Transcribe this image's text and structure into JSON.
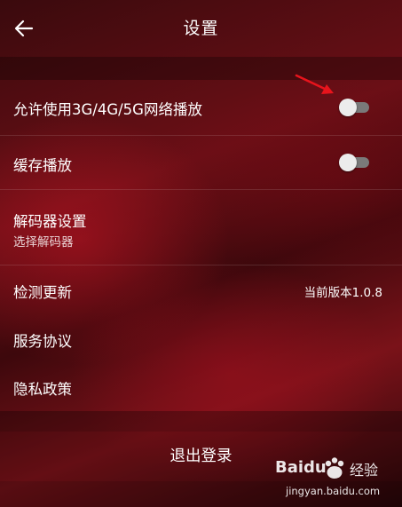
{
  "header": {
    "title": "设置",
    "back_icon": "arrow-left-icon"
  },
  "settings": {
    "allow_network_play": {
      "label": "允许使用3G/4G/5G网络播放",
      "enabled": false
    },
    "cache_play": {
      "label": "缓存播放",
      "enabled": false
    },
    "decoder": {
      "label": "解码器设置",
      "sublabel": "选择解码器"
    },
    "check_update": {
      "label": "检测更新",
      "value": "当前版本1.0.8"
    },
    "service_agreement": {
      "label": "服务协议"
    },
    "privacy_policy": {
      "label": "隐私政策"
    }
  },
  "logout": {
    "label": "退出登录"
  },
  "watermark": {
    "brand": "Baidu",
    "brand_cn": "经验",
    "url": "jingyan.baidu.com"
  },
  "colors": {
    "arrow": "#e8141c",
    "toggle_track": "#7a7a7a",
    "toggle_thumb": "#ececec"
  }
}
